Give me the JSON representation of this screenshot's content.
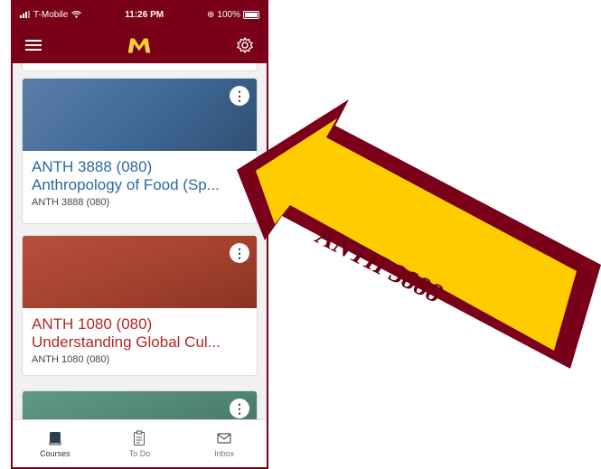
{
  "status_bar": {
    "carrier": "T-Mobile",
    "time": "11:26 PM",
    "battery": "100%"
  },
  "colors": {
    "brand": "#7a0019",
    "gold": "#ffcc33",
    "blue_course": "#2b6aa3",
    "red_course": "#b4262a"
  },
  "nav": {
    "menu_icon": "hamburger-icon",
    "logo": "university-m-logo",
    "settings_icon": "gear-icon"
  },
  "courses": [
    {
      "code": "ANTH 3888 (080)",
      "name": "Anthropology of Food (Sp...",
      "sub": "ANTH 3888 (080)"
    },
    {
      "code": "ANTH 1080 (080)",
      "name": "Understanding Global Cul...",
      "sub": "ANTH 1080 (080)"
    }
  ],
  "tabs": [
    {
      "label": "Courses",
      "icon": "book-icon"
    },
    {
      "label": "To Do",
      "icon": "clipboard-icon"
    },
    {
      "label": "Inbox",
      "icon": "envelope-icon"
    }
  ],
  "annotation": {
    "label": "ANTH 3888"
  }
}
